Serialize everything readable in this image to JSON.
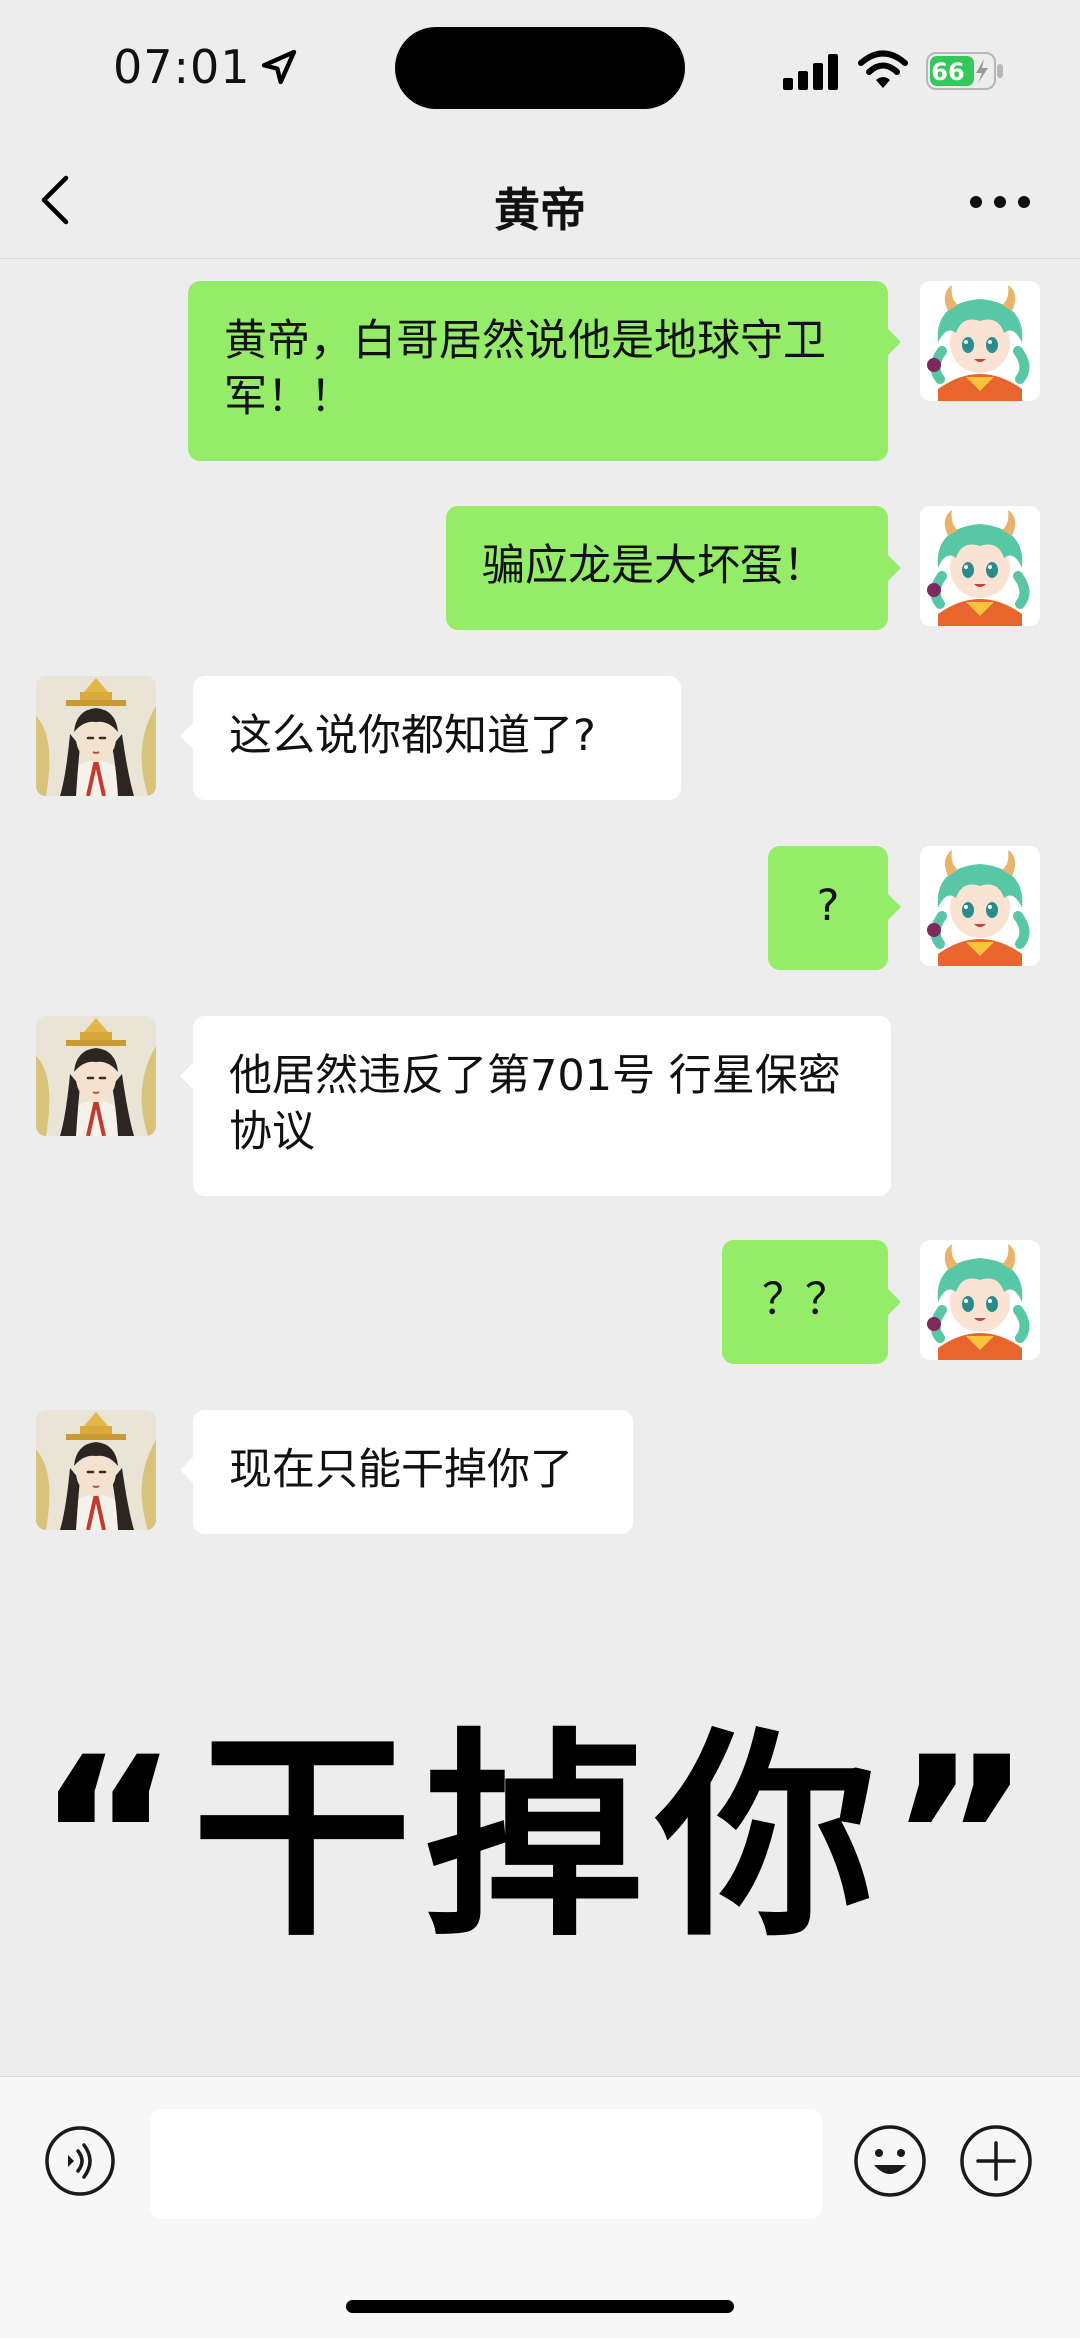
{
  "status_bar": {
    "time": "07:01",
    "battery": "66"
  },
  "nav": {
    "title": "黄帝"
  },
  "messages": [
    {
      "sender": "me",
      "text": "黄帝，白哥居然说他是地球守卫军！！"
    },
    {
      "sender": "me",
      "text": "骗应龙是大坏蛋！"
    },
    {
      "sender": "them",
      "text": "这么说你都知道了?"
    },
    {
      "sender": "me",
      "text": "?"
    },
    {
      "sender": "them",
      "text": "他居然违反了第701号 行星保密协议"
    },
    {
      "sender": "me",
      "text": "？？"
    },
    {
      "sender": "them",
      "text": "现在只能干掉你了"
    }
  ],
  "caption": "“干掉你”",
  "colors": {
    "background": "#ededed",
    "my_bubble": "#95ec69",
    "their_bubble": "#ffffff",
    "battery_fill": "#34c759"
  },
  "icons": {
    "location": "location-arrow-icon",
    "signal": "cellular-signal-icon",
    "wifi": "wifi-icon",
    "battery": "battery-charging-icon",
    "back": "chevron-left-icon",
    "more": "more-dots-icon",
    "voice": "voice-input-icon",
    "emoji": "emoji-icon",
    "plus": "plus-icon"
  }
}
